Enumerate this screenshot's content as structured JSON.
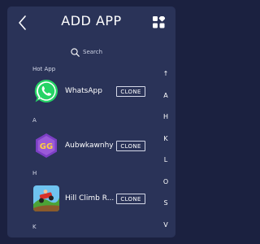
{
  "header": {
    "title": "ADD APP",
    "back_icon": "chevron-left-icon",
    "grid_icon": "grid-icon"
  },
  "search": {
    "label": "Search"
  },
  "sections": [
    {
      "label": "Hot App",
      "app": {
        "name": "WhatsApp",
        "icon": "whatsapp-icon"
      }
    },
    {
      "label": "A",
      "app": {
        "name": "Aubwkawnhy",
        "icon": "gg-icon"
      }
    },
    {
      "label": "H",
      "app": {
        "name": "Hill Climb R...",
        "icon": "hill-climb-icon"
      }
    },
    {
      "label": "K",
      "app": null
    }
  ],
  "clone_label": "CLONE",
  "index_letters": [
    "↑",
    "A",
    "H",
    "K",
    "L",
    "O",
    "S",
    "V"
  ],
  "colors": {
    "background": "#2a3358",
    "frame": "#1b2140",
    "whatsapp": "#25d366",
    "gg": "#7b3fc4"
  }
}
